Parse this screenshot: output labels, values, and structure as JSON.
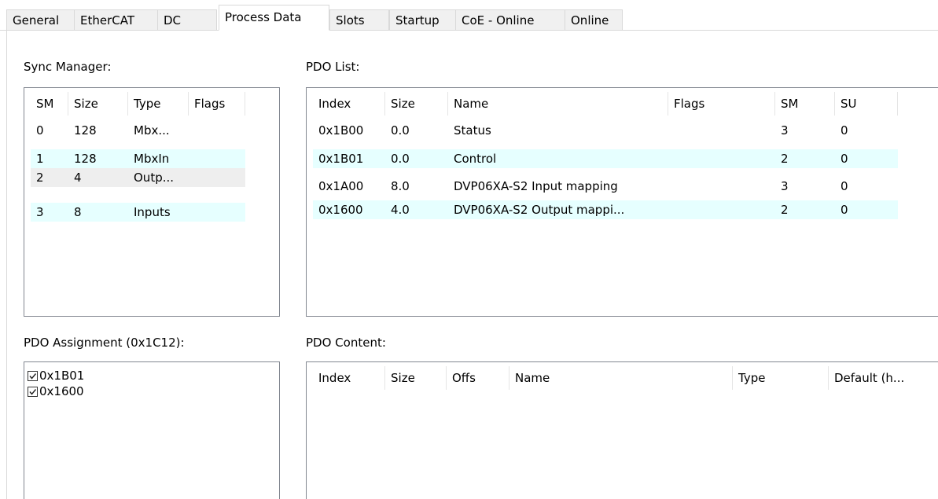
{
  "tabs": [
    "General",
    "EtherCAT",
    "DC",
    "Process Data",
    "Slots",
    "Startup",
    "CoE - Online",
    "Online"
  ],
  "sync_manager": {
    "label": "Sync Manager:",
    "columns": [
      "SM",
      "Size",
      "Type",
      "Flags"
    ],
    "rows": [
      [
        "0",
        "128",
        "Mbx...",
        ""
      ],
      [
        "1",
        "128",
        "MbxIn",
        ""
      ],
      [
        "2",
        "4",
        "Outp...",
        ""
      ],
      [
        "3",
        "8",
        "Inputs",
        ""
      ]
    ]
  },
  "pdo_list": {
    "label": "PDO List:",
    "columns": [
      "Index",
      "Size",
      "Name",
      "Flags",
      "SM",
      "SU"
    ],
    "rows": [
      [
        "0x1B00",
        "0.0",
        "Status",
        "",
        "3",
        "0"
      ],
      [
        "0x1B01",
        "0.0",
        "Control",
        "",
        "2",
        "0"
      ],
      [
        "0x1A00",
        "8.0",
        "DVP06XA-S2 Input mapping",
        "",
        "3",
        "0"
      ],
      [
        "0x1600",
        "4.0",
        "DVP06XA-S2 Output mappi...",
        "",
        "2",
        "0"
      ]
    ]
  },
  "pdo_assignment": {
    "label": "PDO Assignment (0x1C12):",
    "items": [
      {
        "label": "0x1B01",
        "checked": true
      },
      {
        "label": "0x1600",
        "checked": true
      }
    ]
  },
  "pdo_content": {
    "label": "PDO Content:",
    "columns": [
      "Index",
      "Size",
      "Offs",
      "Name",
      "Type",
      "Default (h..."
    ]
  }
}
